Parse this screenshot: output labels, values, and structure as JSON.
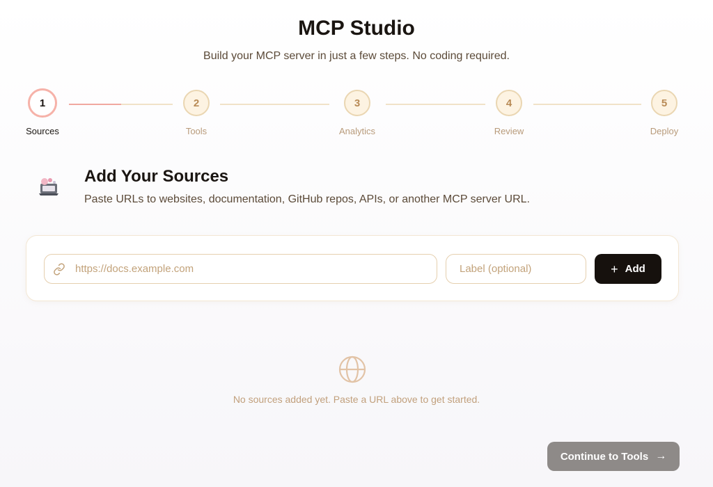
{
  "header": {
    "title": "MCP Studio",
    "subtitle": "Build your MCP server in just a few steps. No coding required."
  },
  "stepper": {
    "current_step": 1,
    "steps": [
      {
        "number": "1",
        "label": "Sources",
        "active": true
      },
      {
        "number": "2",
        "label": "Tools",
        "active": false
      },
      {
        "number": "3",
        "label": "Analytics",
        "active": false
      },
      {
        "number": "4",
        "label": "Review",
        "active": false
      },
      {
        "number": "5",
        "label": "Deploy",
        "active": false
      }
    ]
  },
  "section": {
    "title": "Add Your Sources",
    "description": "Paste URLs to websites, documentation, GitHub repos, APIs, or another MCP server URL."
  },
  "source_form": {
    "url_placeholder": "https://docs.example.com",
    "url_value": "",
    "label_placeholder": "Label (optional)",
    "label_value": "",
    "add_label": "Add"
  },
  "empty_state": {
    "icon": "globe-icon",
    "message": "No sources added yet. Paste a URL above to get started."
  },
  "footer": {
    "continue_label": "Continue to Tools"
  },
  "colors": {
    "accent": "#f6b2a9",
    "primary_button": "#16110d",
    "disabled_button": "#8e8a88",
    "muted_text": "#c1a07c"
  }
}
